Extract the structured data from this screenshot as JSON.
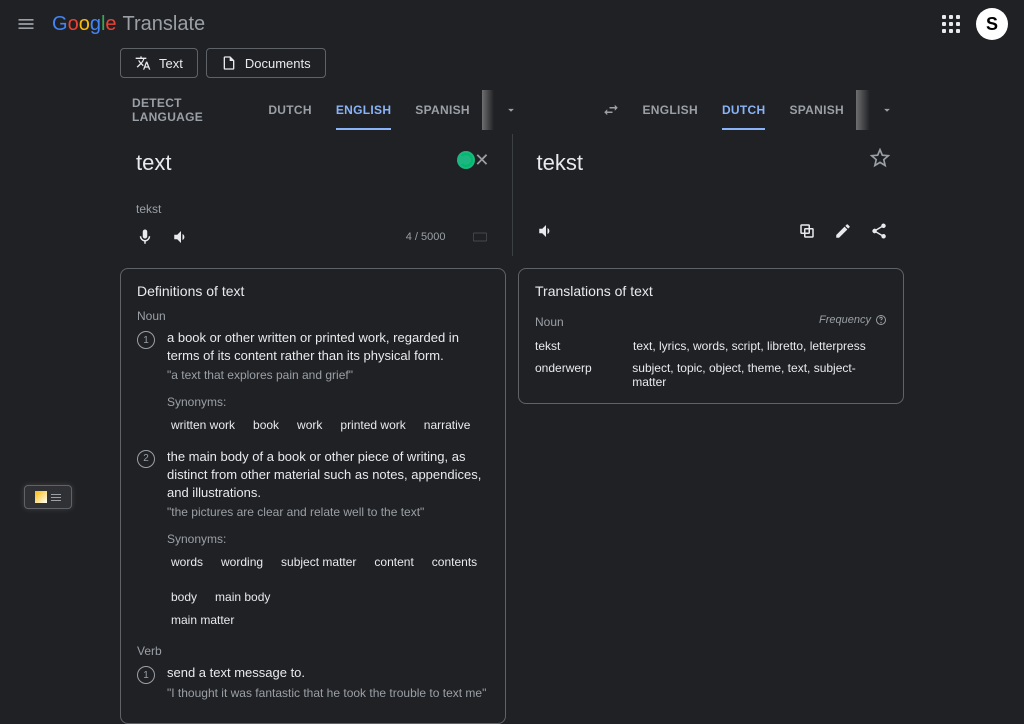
{
  "app": {
    "name_translate": "Translate",
    "avatar_initial": "S"
  },
  "mode_tabs": {
    "text": "Text",
    "documents": "Documents"
  },
  "source_langs": {
    "detect": "DETECT LANGUAGE",
    "l1": "DUTCH",
    "l2": "ENGLISH",
    "l3": "SPANISH"
  },
  "target_langs": {
    "l1": "ENGLISH",
    "l2": "DUTCH",
    "l3": "SPANISH"
  },
  "source": {
    "text": "text",
    "translit": "tekst",
    "charcount": "4 / 5000"
  },
  "target": {
    "text": "tekst"
  },
  "definitions": {
    "title": "Definitions of text",
    "noun_label": "Noun",
    "verb_label": "Verb",
    "noun1": {
      "text": "a book or other written or printed work, regarded in terms of its content rather than its physical form.",
      "example": "\"a text that explores pain and grief\"",
      "syn_label": "Synonyms:",
      "syns": [
        "written work",
        "book",
        "work",
        "printed work",
        "narrative"
      ]
    },
    "noun2": {
      "text": "the main body of a book or other piece of writing, as distinct from other material such as notes, appendices, and illustrations.",
      "example": "\"the pictures are clear and relate well to the text\"",
      "syn_label": "Synonyms:",
      "syns": [
        "words",
        "wording",
        "subject matter",
        "content",
        "contents",
        "body",
        "main body",
        "main matter"
      ]
    },
    "verb1": {
      "text": "send a text message to.",
      "example": "\"I thought it was fantastic that he took the trouble to text me\""
    }
  },
  "translations": {
    "title": "Translations of text",
    "noun_label": "Noun",
    "frequency_label": "Frequency",
    "row1": {
      "word": "tekst",
      "syns": "text, lyrics, words, script, libretto, letterpress"
    },
    "row2": {
      "word": "onderwerp",
      "syns": "subject, topic, object, theme, text, subject-matter"
    }
  }
}
